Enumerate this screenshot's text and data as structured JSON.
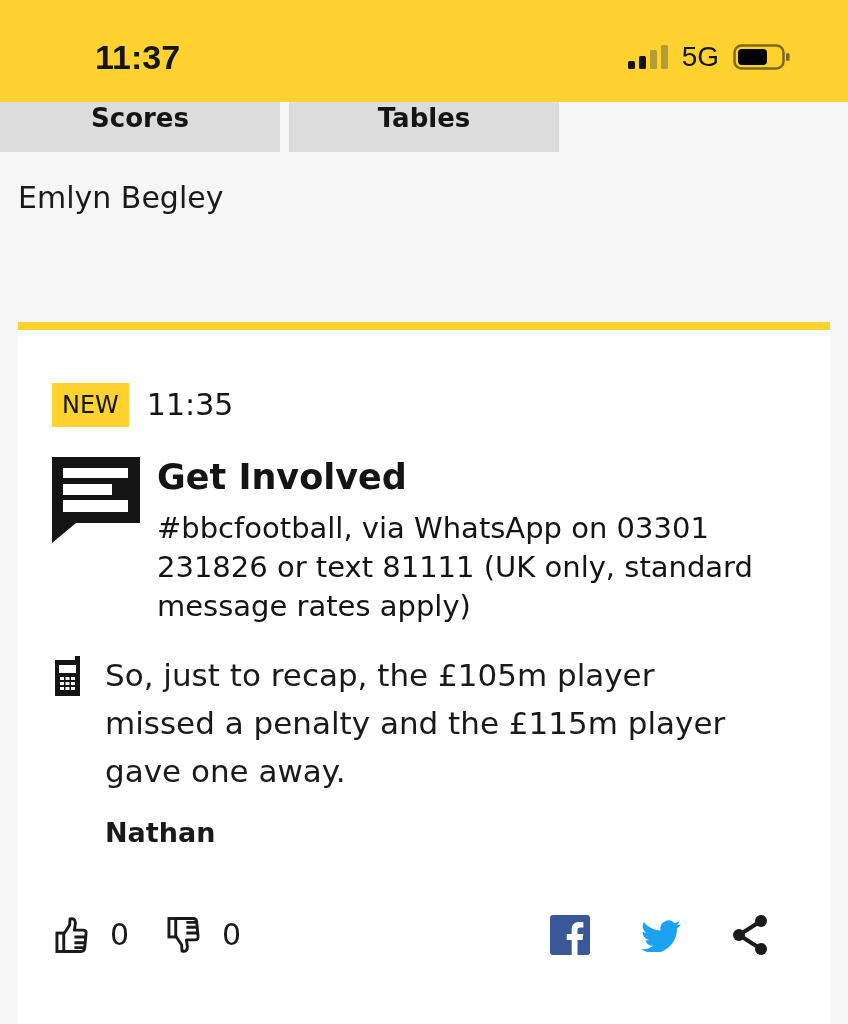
{
  "status_bar": {
    "time": "11:37",
    "network": "5G"
  },
  "tabs": [
    {
      "label": "Scores",
      "selected": false
    },
    {
      "label": "Tables",
      "selected": false
    }
  ],
  "author": "Emlyn Begley",
  "post": {
    "badge": "NEW",
    "time": "11:35",
    "title": "Get Involved",
    "body": "#bbcfootball, via WhatsApp on 03301 231826 or text 81111 (UK only, standard message rates apply)",
    "message": {
      "text": "So, just to recap, the £105m player missed a penalty and the £115m player gave one away.",
      "sender": "Nathan"
    },
    "reactions": [
      {
        "kind": "like",
        "count": "0"
      },
      {
        "kind": "dislike",
        "count": "0"
      }
    ]
  }
}
